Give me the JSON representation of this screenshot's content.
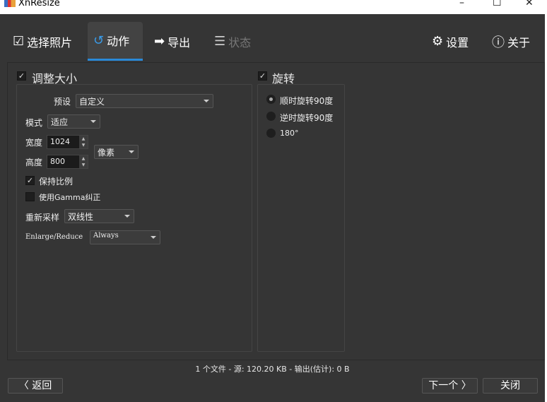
{
  "window": {
    "title": "XnResize",
    "minimize": "–",
    "maximize": "☐",
    "close": "✕"
  },
  "tabs": [
    {
      "label": "选择照片"
    },
    {
      "label": "动作"
    },
    {
      "label": "导出"
    },
    {
      "label": "状态"
    }
  ],
  "toolbar": {
    "settings": "设置",
    "about": "关于"
  },
  "resize": {
    "title": "调整大小",
    "checked": true,
    "preset_label": "预设",
    "preset_value": "自定义",
    "mode_label": "模式",
    "mode_value": "适应",
    "width_label": "宽度",
    "width_value": "1024",
    "height_label": "高度",
    "height_value": "800",
    "unit_value": "像素",
    "keep_ratio": "保持比例",
    "gamma": "使用Gamma纠正",
    "resample_label": "重新采样",
    "resample_value": "双线性",
    "enlarge_label": "Enlarge/Reduce",
    "enlarge_value": "Always"
  },
  "rotate": {
    "title": "旋转",
    "checked": true,
    "options": [
      {
        "label": "顺时旋转90度",
        "selected": true
      },
      {
        "label": "逆时旋转90度",
        "selected": false
      },
      {
        "label": "180°",
        "selected": false
      }
    ]
  },
  "status": "1 个文件 - 源: 120.20 KB - 输出(估计): 0 B",
  "footer": {
    "back": "〈 返回",
    "next": "下一个 〉",
    "close": "关闭"
  }
}
